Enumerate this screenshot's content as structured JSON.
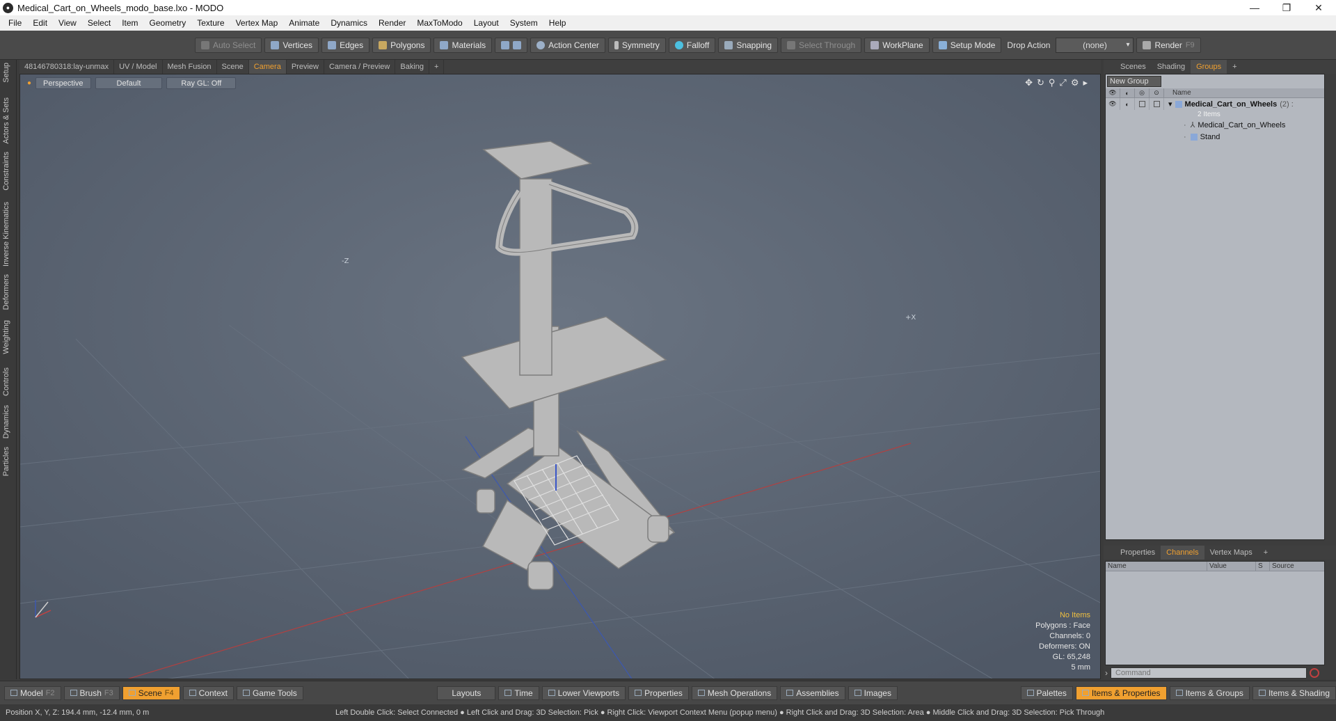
{
  "window": {
    "title": "Medical_Cart_on_Wheels_modo_base.lxo - MODO",
    "app_icon": "modo-icon"
  },
  "menu": [
    "File",
    "Edit",
    "View",
    "Select",
    "Item",
    "Geometry",
    "Texture",
    "Vertex Map",
    "Animate",
    "Dynamics",
    "Render",
    "MaxToModo",
    "Layout",
    "System",
    "Help"
  ],
  "toolbar": {
    "auto_select": "Auto Select",
    "vertices": "Vertices",
    "edges": "Edges",
    "polygons": "Polygons",
    "materials": "Materials",
    "action_center": "Action Center",
    "symmetry": "Symmetry",
    "falloff": "Falloff",
    "snapping": "Snapping",
    "select_through": "Select Through",
    "workplane": "WorkPlane",
    "setup_mode": "Setup Mode",
    "drop_action_label": "Drop Action",
    "drop_action_value": "(none)",
    "render": "Render",
    "render_key": "F9"
  },
  "left_tabs": [
    "Setup",
    "Actors & Sets",
    "Constraints",
    "Inverse Kinematics",
    "Deformers",
    "Weighting",
    "Controls",
    "Dynamics",
    "Particles"
  ],
  "viewport_tabs": [
    "48146780318:lay-unmax",
    "UV / Model",
    "Mesh Fusion",
    "Scene",
    "Camera",
    "Preview",
    "Camera / Preview",
    "Baking",
    "+"
  ],
  "viewport_active_tab": "Camera",
  "viewport": {
    "view_mode": "Perspective",
    "shading": "Default",
    "raygl": "Ray GL: Off",
    "axis_z": "-Z",
    "axis_x": "+X",
    "info": {
      "items": "No Items",
      "polygons": "Polygons : Face",
      "channels": "Channels: 0",
      "deformers": "Deformers: ON",
      "gl": "GL: 65,248",
      "grid": "5 mm"
    }
  },
  "right_tabs": [
    "Scenes",
    "Shading",
    "Groups",
    "+"
  ],
  "right_active_tab": "Groups",
  "groups": {
    "new_group": "New Group",
    "name_header": "Name",
    "root": {
      "name": "Medical_Cart_on_Wheels",
      "count": "(2) :",
      "sub": "2 Items"
    },
    "children": [
      "Medical_Cart_on_Wheels",
      "Stand"
    ]
  },
  "lower_tabs": [
    "Properties",
    "Channels",
    "Vertex Maps",
    "+"
  ],
  "lower_active_tab": "Channels",
  "channels_headers": [
    "Name",
    "Value",
    "S",
    "Source"
  ],
  "command_placeholder": "Command",
  "bottom": {
    "model": "Model",
    "model_key": "F2",
    "brush": "Brush",
    "brush_key": "F3",
    "scene": "Scene",
    "scene_key": "F4",
    "context": "Context",
    "game_tools": "Game Tools",
    "layouts": "Layouts",
    "time": "Time",
    "lower_viewports": "Lower Viewports",
    "properties": "Properties",
    "mesh_operations": "Mesh Operations",
    "assemblies": "Assemblies",
    "images": "Images",
    "palettes": "Palettes",
    "items_properties": "Items & Properties",
    "items_groups": "Items & Groups",
    "items_shading": "Items & Shading"
  },
  "status": {
    "position": "Position X, Y, Z:   194.4 mm, -12.4 mm, 0 m",
    "hints": "Left Double Click: Select Connected ● Left Click and Drag: 3D Selection: Pick ● Right Click: Viewport Context Menu (popup menu) ● Right Click and Drag: 3D Selection: Area ● Middle Click and Drag: 3D Selection: Pick Through"
  },
  "colors": {
    "accent": "#f0a030",
    "viewport_bg": "#5a6472",
    "panel_bg": "#b4b8bf"
  }
}
